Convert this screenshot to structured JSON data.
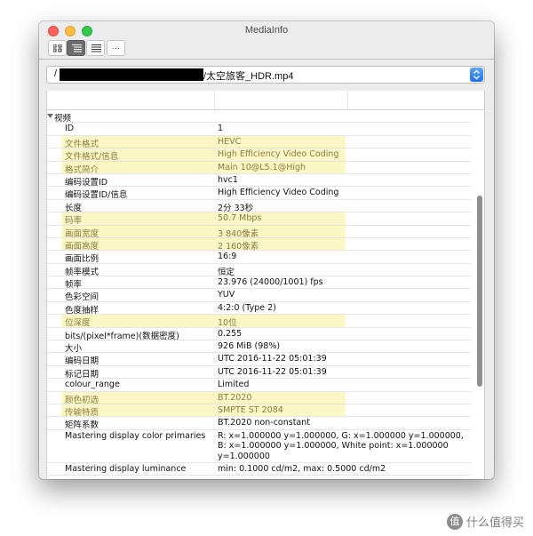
{
  "window": {
    "title": "MediaInfo"
  },
  "path": {
    "prefix": "/",
    "filename": "/太空旅客_HDR.mp4"
  },
  "toolbar": {
    "more_label": "..."
  },
  "section": {
    "label": "视频"
  },
  "rows": [
    {
      "key": "ID",
      "value": "1",
      "hl": false
    },
    {
      "key": "文件格式",
      "value": "HEVC",
      "hl": true
    },
    {
      "key": "文件格式/信息",
      "value": "High Efficiency Video Coding",
      "hl": true
    },
    {
      "key": "格式简介",
      "value": "Main 10@L5.1@High",
      "hl": true
    },
    {
      "key": "编码设置ID",
      "value": "hvc1",
      "hl": false
    },
    {
      "key": "编码设置ID/信息",
      "value": "High Efficiency Video Coding",
      "hl": false
    },
    {
      "key": "长度",
      "value": "2分 33秒",
      "hl": false
    },
    {
      "key": "码率",
      "value": "50.7 Mbps",
      "hl": true
    },
    {
      "key": "画面宽度",
      "value": "3 840像素",
      "hl": true
    },
    {
      "key": "画面高度",
      "value": "2 160像素",
      "hl": true
    },
    {
      "key": "画面比例",
      "value": "16:9",
      "hl": false
    },
    {
      "key": "帧率模式",
      "value": "恒定",
      "hl": false
    },
    {
      "key": "帧率",
      "value": "23.976 (24000/1001) fps",
      "hl": false
    },
    {
      "key": "色彩空间",
      "value": "YUV",
      "hl": false
    },
    {
      "key": "色度抽样",
      "value": "4:2:0 (Type 2)",
      "hl": false
    },
    {
      "key": "位深度",
      "value": "10位",
      "hl": true
    },
    {
      "key": "bits/(pixel*frame)(数据密度)",
      "value": "0.255",
      "hl": false
    },
    {
      "key": "大小",
      "value": "926 MiB (98%)",
      "hl": false
    },
    {
      "key": "编码日期",
      "value": "UTC 2016-11-22 05:01:39",
      "hl": false
    },
    {
      "key": "标记日期",
      "value": "UTC 2016-11-22 05:01:39",
      "hl": false
    },
    {
      "key": "colour_range",
      "value": "Limited",
      "hl": false
    },
    {
      "key": "颜色初选",
      "value": "BT.2020",
      "hl": true
    },
    {
      "key": "传输特质",
      "value": "SMPTE ST 2084",
      "hl": true
    },
    {
      "key": "矩阵系数",
      "value": "BT.2020 non-constant",
      "hl": false
    },
    {
      "key": "Mastering display color primaries",
      "value": "R: x=1.000000 y=1.000000, G: x=1.000000 y=1.000000, B: x=1.000000 y=1.000000, White point: x=1.000000 y=1.000000",
      "hl": false,
      "tall": true
    },
    {
      "key": "Mastering display luminance",
      "value": "min: 0.1000 cd/m2, max: 0.5000 cd/m2",
      "hl": false
    }
  ],
  "watermark": {
    "logo": "值",
    "text": "什么值得买"
  },
  "colors": {
    "highlight_bg": "#fbf7c6",
    "highlight_text": "#8a7c3a",
    "accent": "#1f71e7"
  }
}
